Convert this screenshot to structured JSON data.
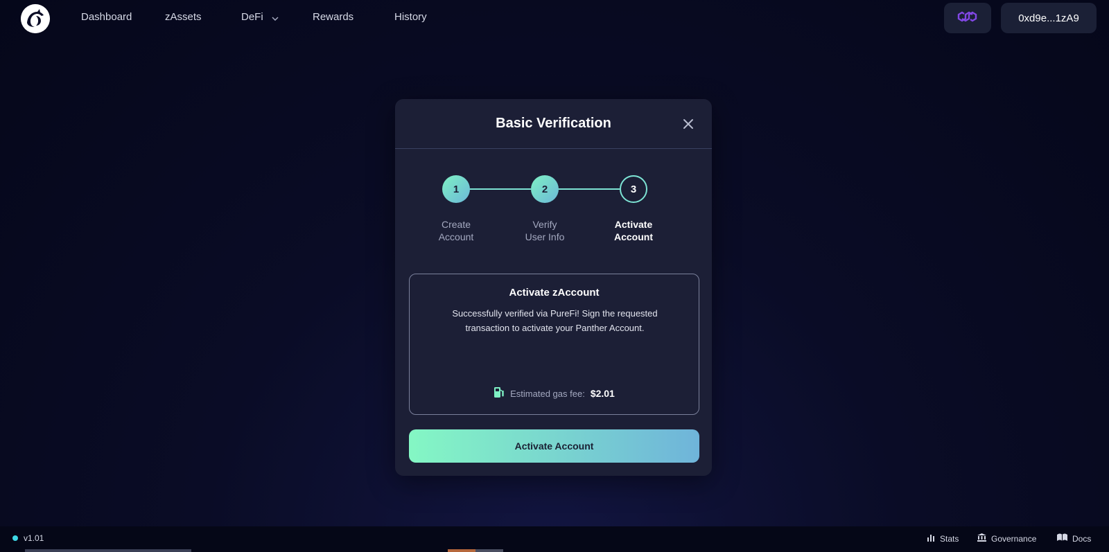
{
  "nav": {
    "items": [
      {
        "label": "Dashboard"
      },
      {
        "label": "zAssets"
      },
      {
        "label": "DeFi"
      },
      {
        "label": "Rewards"
      },
      {
        "label": "History"
      }
    ],
    "chain_icon": "polygon-icon",
    "wallet_address": "0xd9e...1zA9"
  },
  "modal": {
    "title": "Basic Verification",
    "steps": [
      {
        "number": "1",
        "label_line1": "Create",
        "label_line2": "Account",
        "state": "done"
      },
      {
        "number": "2",
        "label_line1": "Verify",
        "label_line2": "User Info",
        "state": "done"
      },
      {
        "number": "3",
        "label_line1": "Activate",
        "label_line2": "Account",
        "state": "active"
      }
    ],
    "info": {
      "title": "Activate zAccount",
      "text": "Successfully verified via PureFi! Sign the requested transaction to activate your Panther Account.",
      "gas_label": "Estimated gas fee:",
      "gas_value": "$2.01"
    },
    "button_label": "Activate Account"
  },
  "footer": {
    "version": "v1.01",
    "links": [
      {
        "label": "Stats",
        "icon": "bar-chart-icon"
      },
      {
        "label": "Governance",
        "icon": "bank-icon"
      },
      {
        "label": "Docs",
        "icon": "book-icon"
      }
    ]
  },
  "colors": {
    "accent_start": "#84f7c4",
    "accent_end": "#6fb4da",
    "polygon": "#8247e5",
    "status_dot": "#3ed8e6"
  }
}
